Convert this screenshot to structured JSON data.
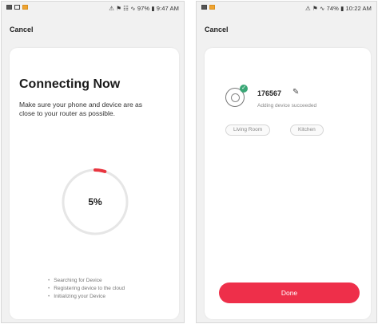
{
  "colors": {
    "accent": "#ee2f4a",
    "progress_arc": "#e8353f",
    "success": "#3aa776",
    "ring": "#e6e6e6"
  },
  "left_screen": {
    "status_time": "⚠ ⚑ ☷ ∿ 97% ▮ 9:47 AM",
    "cancel_label": "Cancel",
    "title": "Connecting Now",
    "description": "Make sure your phone and device are as close to your router as possible.",
    "progress_percent": 5,
    "progress_label": "5%",
    "steps": [
      "Searching for Device",
      "Registering device to the cloud",
      "Initializing your Device"
    ]
  },
  "right_screen": {
    "status_time": "⚠ ⚑ ∿ 74% ▮ 10:22 AM",
    "cancel_label": "Cancel",
    "device_icon": "smart-plug-icon",
    "check_icon": "✓",
    "edit_icon": "✎",
    "device_name": "176567",
    "device_status": "Adding device succeeded",
    "rooms": [
      "Living Room",
      "Kitchen"
    ],
    "done_label": "Done"
  }
}
